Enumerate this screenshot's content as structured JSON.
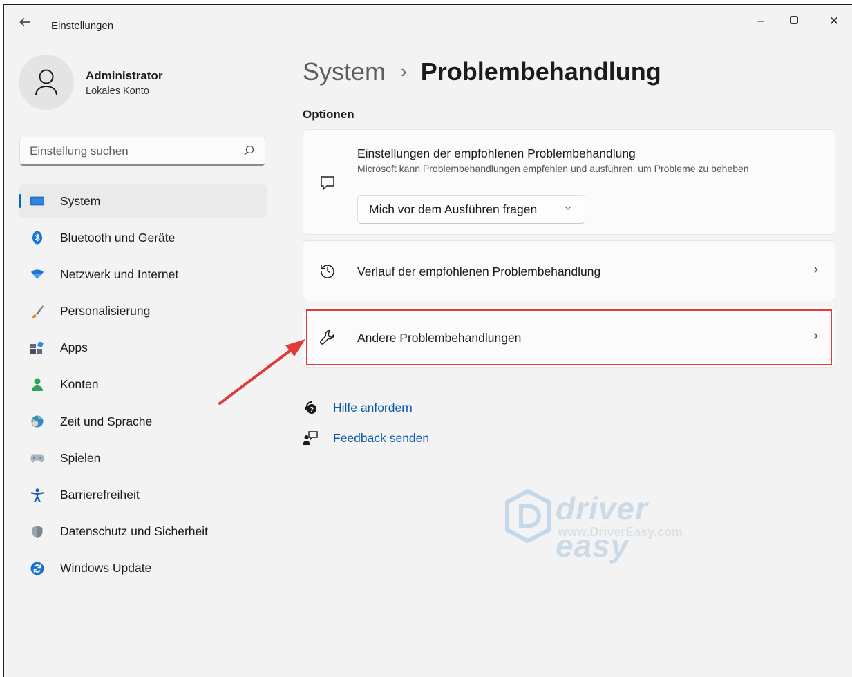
{
  "window": {
    "app_title": "Einstellungen",
    "controls": {
      "minimize": "–",
      "maximize": "☐",
      "close": "✕"
    }
  },
  "profile": {
    "name": "Administrator",
    "subtitle": "Lokales Konto"
  },
  "search": {
    "placeholder": "Einstellung suchen"
  },
  "sidebar": {
    "items": [
      {
        "label": "System",
        "icon": "system-icon",
        "active": true
      },
      {
        "label": "Bluetooth und Geräte",
        "icon": "bluetooth-icon"
      },
      {
        "label": "Netzwerk und Internet",
        "icon": "wifi-icon"
      },
      {
        "label": "Personalisierung",
        "icon": "brush-icon"
      },
      {
        "label": "Apps",
        "icon": "apps-icon"
      },
      {
        "label": "Konten",
        "icon": "person-icon"
      },
      {
        "label": "Zeit und Sprache",
        "icon": "globe-clock-icon"
      },
      {
        "label": "Spielen",
        "icon": "gamepad-icon"
      },
      {
        "label": "Barrierefreiheit",
        "icon": "accessibility-icon"
      },
      {
        "label": "Datenschutz und Sicherheit",
        "icon": "shield-icon"
      },
      {
        "label": "Windows Update",
        "icon": "update-icon"
      }
    ]
  },
  "main": {
    "breadcrumb": {
      "parent": "System",
      "separator": "›",
      "current": "Problembehandlung"
    },
    "section_title": "Optionen",
    "cards": [
      {
        "title": "Einstellungen der empfohlenen Problembehandlung",
        "description": "Microsoft kann Problembehandlungen empfehlen und ausführen, um Probleme zu beheben",
        "dropdown_value": "Mich vor dem Ausführen fragen",
        "icon": "chat-icon"
      },
      {
        "title": "Verlauf der empfohlenen Problembehandlung",
        "icon": "history-icon",
        "chevron": "›"
      },
      {
        "title": "Andere Problembehandlungen",
        "icon": "wrench-icon",
        "chevron": "›"
      }
    ],
    "links": [
      {
        "label": "Hilfe anfordern",
        "icon": "help-icon"
      },
      {
        "label": "Feedback senden",
        "icon": "feedback-icon"
      }
    ]
  },
  "watermark": {
    "brand": "driver easy",
    "url": "www.DriverEasy.com"
  },
  "colors": {
    "accent": "#0067c0",
    "link": "#0a5aa8",
    "highlight": "#e03a3a",
    "background": "#f3f3f3",
    "card": "#fbfbfb"
  }
}
